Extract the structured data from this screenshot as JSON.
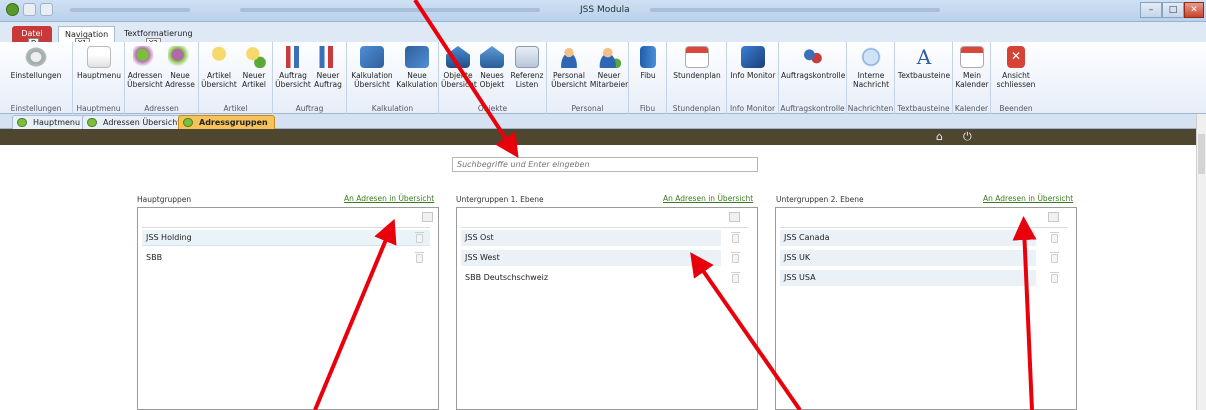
{
  "window": {
    "title": "JSS Modula",
    "min": "–",
    "max": "□",
    "close": "✕"
  },
  "ribbon_tabs": {
    "file": "Datei",
    "navigation": "Navigation",
    "text": "Textformatierung",
    "keytips": {
      "file": "D",
      "navigation": "Y1",
      "text": "Y2"
    }
  },
  "ribbon": {
    "groups": [
      {
        "label": "Einstellungen",
        "buttons": [
          "Einstellungen"
        ]
      },
      {
        "label": "Hauptmenu",
        "buttons": [
          "Hauptmenu"
        ]
      },
      {
        "label": "Adressen",
        "buttons": [
          "Adressen Übersicht",
          "Neue Adresse"
        ]
      },
      {
        "label": "Artikel",
        "buttons": [
          "Artikel Übersicht",
          "Neuer Artikel"
        ]
      },
      {
        "label": "Auftrag",
        "buttons": [
          "Auftrag Übersicht",
          "Neuer Auftrag"
        ]
      },
      {
        "label": "Kalkulation",
        "buttons": [
          "Kalkulation Übersicht",
          "Neue Kalkulation"
        ]
      },
      {
        "label": "Objekte",
        "buttons": [
          "Objekte Übersicht",
          "Neues Objekt",
          "Referenz Listen"
        ]
      },
      {
        "label": "Personal",
        "buttons": [
          "Personal Übersicht",
          "Neuer Mitarbeier"
        ]
      },
      {
        "label": "Fibu",
        "buttons": [
          "Fibu"
        ]
      },
      {
        "label": "Stundenplan",
        "buttons": [
          "Stundenplan"
        ]
      },
      {
        "label": "Info Monitor",
        "buttons": [
          "Info Monitor"
        ]
      },
      {
        "label": "Auftragskontrolle",
        "buttons": [
          "Auftragskontrolle"
        ]
      },
      {
        "label": "Nachrichten",
        "buttons": [
          "Interne Nachricht"
        ]
      },
      {
        "label": "Textbausteine",
        "buttons": [
          "Textbausteine"
        ]
      },
      {
        "label": "Kalender",
        "buttons": [
          "Mein Kalender"
        ]
      },
      {
        "label": "Beenden",
        "buttons": [
          "Ansicht schliessen"
        ]
      }
    ]
  },
  "doc_tabs": [
    "Hauptmenu",
    "Adressen Übersicht",
    "Adressgruppen"
  ],
  "search": {
    "placeholder": "Suchbegriffe und Enter eingeben"
  },
  "columns": [
    {
      "title": "Hauptgruppen",
      "link": "An Adresen in Übersicht",
      "items": [
        "JSS Holding",
        "SBB"
      ]
    },
    {
      "title": "Untergruppen 1. Ebene",
      "link": "An Adresen in Übersicht",
      "items": [
        "JSS Ost",
        "JSS West",
        "SBB Deutschschweiz"
      ]
    },
    {
      "title": "Untergruppen 2. Ebene",
      "link": "An Adresen in Übersicht",
      "items": [
        "JSS Canada",
        "JSS UK",
        "JSS USA"
      ]
    }
  ],
  "icons": {
    "home": "home-icon",
    "power": "power-icon",
    "trash": "trash-icon"
  },
  "colors": {
    "accent_dark_bar": "#4f4630",
    "link_green": "#3b7d1e",
    "active_tab": "#f6c35b",
    "arrow_red": "#e8000b"
  }
}
